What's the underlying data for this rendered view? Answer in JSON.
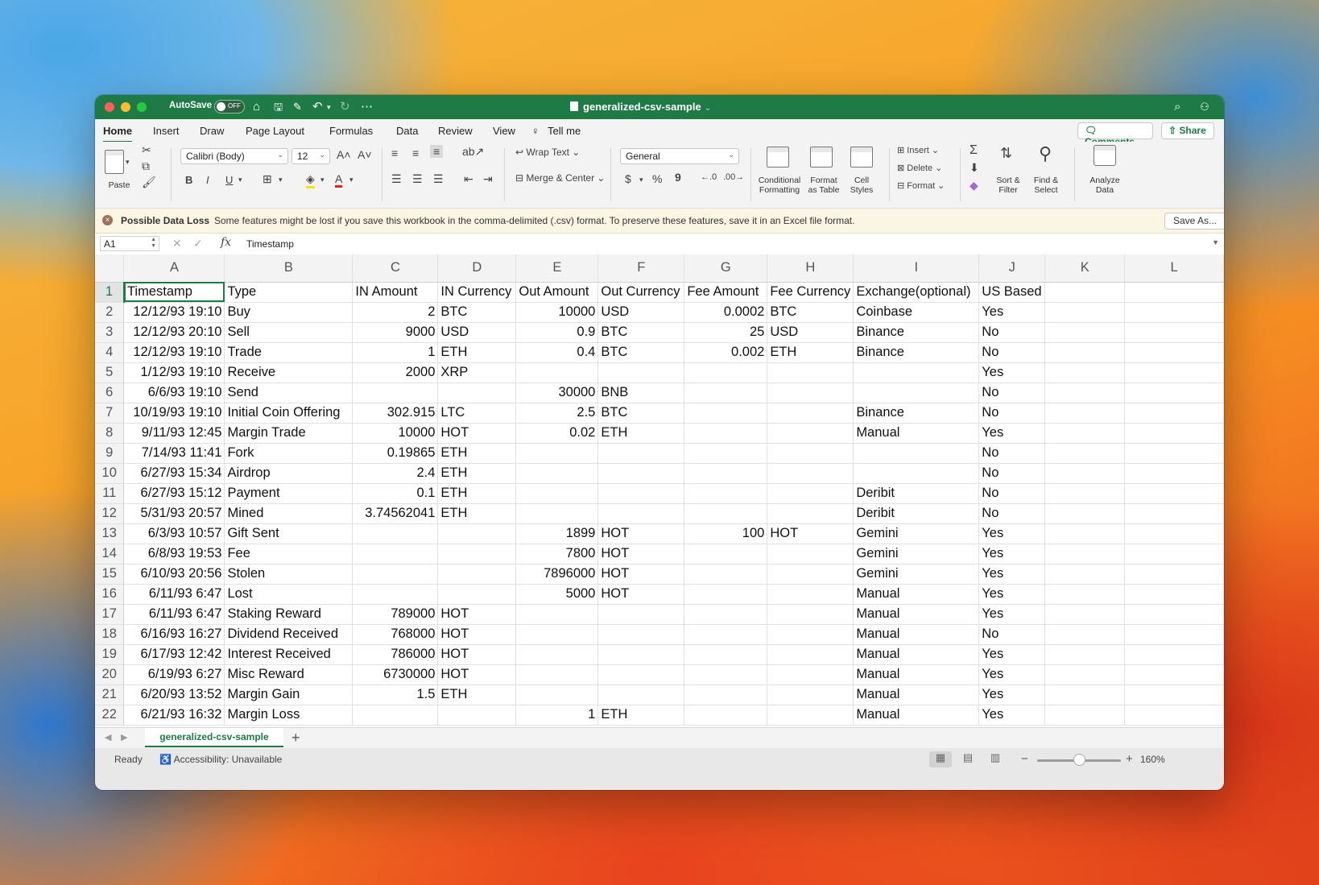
{
  "title_bar": {
    "autosave_label": "AutoSave",
    "autosave_state": "OFF",
    "document_title": "generalized-csv-sample"
  },
  "ribbon_tabs": [
    "Home",
    "Insert",
    "Draw",
    "Page Layout",
    "Formulas",
    "Data",
    "Review",
    "View",
    "Tell me"
  ],
  "header_buttons": {
    "comments": "Comments",
    "share": "Share"
  },
  "ribbon": {
    "paste": "Paste",
    "font_name": "Calibri (Body)",
    "font_size": "12",
    "wrap_text": "Wrap Text",
    "merge_center": "Merge & Center",
    "number_format": "General",
    "conditional_formatting": [
      "Conditional",
      "Formatting"
    ],
    "format_as_table": [
      "Format",
      "as Table"
    ],
    "cell_styles": [
      "Cell",
      "Styles"
    ],
    "insert": "Insert",
    "delete": "Delete",
    "format": "Format",
    "sort_filter": [
      "Sort &",
      "Filter"
    ],
    "find_select": [
      "Find &",
      "Select"
    ],
    "analyze_data": [
      "Analyze",
      "Data"
    ],
    "bold": "B",
    "italic": "I",
    "underline": "U",
    "currency": "$",
    "percent": "%",
    "comma": "9"
  },
  "message_bar": {
    "title": "Possible Data Loss",
    "text": "Some features might be lost if you save this workbook in the comma-delimited (.csv) format. To preserve these features, save it in an Excel file format.",
    "button": "Save As..."
  },
  "formula_bar": {
    "name_box": "A1",
    "fx": "fx",
    "value": "Timestamp"
  },
  "sheet": {
    "columns": [
      "A",
      "B",
      "C",
      "D",
      "E",
      "F",
      "G",
      "H",
      "I",
      "J",
      "K",
      "L"
    ],
    "rows": [
      [
        "Timestamp",
        "Type",
        "IN Amount",
        "IN Currency",
        "Out Amount",
        "Out Currency",
        "Fee Amount",
        "Fee Currency",
        "Exchange(optional)",
        "US Based",
        "",
        ""
      ],
      [
        "12/12/93 19:10",
        "Buy",
        "2",
        "BTC",
        "10000",
        "USD",
        "0.0002",
        "BTC",
        "Coinbase",
        "Yes",
        "",
        ""
      ],
      [
        "12/12/93 20:10",
        "Sell",
        "9000",
        "USD",
        "0.9",
        "BTC",
        "25",
        "USD",
        "Binance",
        "No",
        "",
        ""
      ],
      [
        "12/12/93 19:10",
        "Trade",
        "1",
        "ETH",
        "0.4",
        "BTC",
        "0.002",
        "ETH",
        "Binance",
        "No",
        "",
        ""
      ],
      [
        "1/12/93 19:10",
        "Receive",
        "2000",
        "XRP",
        "",
        "",
        "",
        "",
        "",
        "Yes",
        "",
        ""
      ],
      [
        "6/6/93 19:10",
        "Send",
        "",
        "",
        "30000",
        "BNB",
        "",
        "",
        "",
        "No",
        "",
        ""
      ],
      [
        "10/19/93 19:10",
        "Initial Coin Offering",
        "302.915",
        "LTC",
        "2.5",
        "BTC",
        "",
        "",
        "Binance",
        "No",
        "",
        ""
      ],
      [
        "9/11/93 12:45",
        "Margin Trade",
        "10000",
        "HOT",
        "0.02",
        "ETH",
        "",
        "",
        "Manual",
        "Yes",
        "",
        ""
      ],
      [
        "7/14/93 11:41",
        "Fork",
        "0.19865",
        "ETH",
        "",
        "",
        "",
        "",
        "",
        "No",
        "",
        ""
      ],
      [
        "6/27/93 15:34",
        "Airdrop",
        "2.4",
        "ETH",
        "",
        "",
        "",
        "",
        "",
        "No",
        "",
        ""
      ],
      [
        "6/27/93 15:12",
        "Payment",
        "0.1",
        "ETH",
        "",
        "",
        "",
        "",
        "Deribit",
        "No",
        "",
        ""
      ],
      [
        "5/31/93 20:57",
        "Mined",
        "3.74562041",
        "ETH",
        "",
        "",
        "",
        "",
        "Deribit",
        "No",
        "",
        ""
      ],
      [
        "6/3/93 10:57",
        "Gift Sent",
        "",
        "",
        "1899",
        "HOT",
        "100",
        "HOT",
        "Gemini",
        "Yes",
        "",
        ""
      ],
      [
        "6/8/93 19:53",
        "Fee",
        "",
        "",
        "7800",
        "HOT",
        "",
        "",
        "Gemini",
        "Yes",
        "",
        ""
      ],
      [
        "6/10/93 20:56",
        "Stolen",
        "",
        "",
        "7896000",
        "HOT",
        "",
        "",
        "Gemini",
        "Yes",
        "",
        ""
      ],
      [
        "6/11/93 6:47",
        "Lost",
        "",
        "",
        "5000",
        "HOT",
        "",
        "",
        "Manual",
        "Yes",
        "",
        ""
      ],
      [
        "6/11/93 6:47",
        "Staking Reward",
        "789000",
        "HOT",
        "",
        "",
        "",
        "",
        "Manual",
        "Yes",
        "",
        ""
      ],
      [
        "6/16/93 16:27",
        "Dividend Received",
        "768000",
        "HOT",
        "",
        "",
        "",
        "",
        "Manual",
        "No",
        "",
        ""
      ],
      [
        "6/17/93 12:42",
        "Interest Received",
        "786000",
        "HOT",
        "",
        "",
        "",
        "",
        "Manual",
        "Yes",
        "",
        ""
      ],
      [
        "6/19/93 6:27",
        "Misc Reward",
        "6730000",
        "HOT",
        "",
        "",
        "",
        "",
        "Manual",
        "Yes",
        "",
        ""
      ],
      [
        "6/20/93 13:52",
        "Margin Gain",
        "1.5",
        "ETH",
        "",
        "",
        "",
        "",
        "Manual",
        "Yes",
        "",
        ""
      ],
      [
        "6/21/93 16:32",
        "Margin Loss",
        "",
        "",
        "1",
        "ETH",
        "",
        "",
        "Manual",
        "Yes",
        "",
        ""
      ]
    ]
  },
  "sheet_tab": "generalized-csv-sample",
  "status_bar": {
    "ready": "Ready",
    "accessibility": "Accessibility: Unavailable",
    "zoom": "160%",
    "zoom_fraction": 0.5
  }
}
